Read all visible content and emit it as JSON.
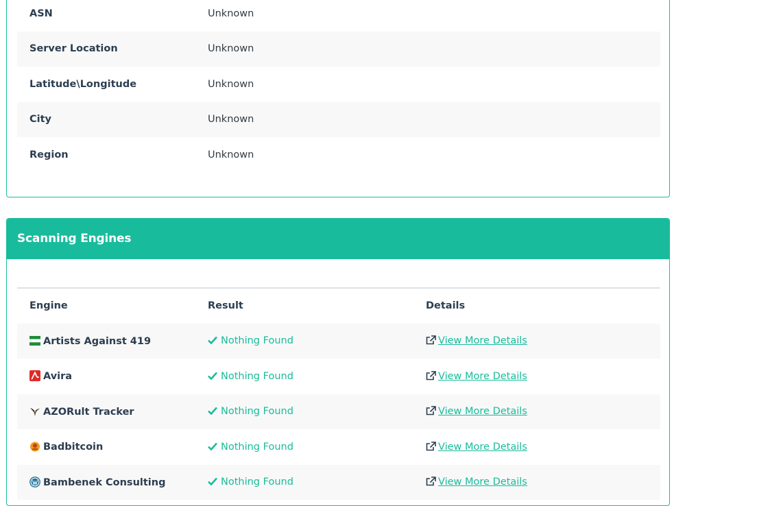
{
  "server_info": {
    "rows": [
      {
        "label": "ASN",
        "value": "Unknown"
      },
      {
        "label": "Server Location",
        "value": "Unknown"
      },
      {
        "label": "Latitude\\Longitude",
        "value": "Unknown"
      },
      {
        "label": "City",
        "value": "Unknown"
      },
      {
        "label": "Region",
        "value": "Unknown"
      }
    ]
  },
  "scanning_engines": {
    "title": "Scanning Engines",
    "columns": {
      "engine": "Engine",
      "result": "Result",
      "details": "Details"
    },
    "rows": [
      {
        "name": "Artists Against 419",
        "icon": "flag-nigeria-icon",
        "result": "Nothing Found",
        "details": "View More Details"
      },
      {
        "name": "Avira",
        "icon": "avira-logo-icon",
        "result": "Nothing Found",
        "details": "View More Details"
      },
      {
        "name": "AZORult Tracker",
        "icon": "bird-icon",
        "result": "Nothing Found",
        "details": "View More Details"
      },
      {
        "name": "Badbitcoin",
        "icon": "badbitcoin-logo-icon",
        "result": "Nothing Found",
        "details": "View More Details"
      },
      {
        "name": "Bambenek Consulting",
        "icon": "wordpress-logo-icon",
        "result": "Nothing Found",
        "details": "View More Details"
      }
    ]
  },
  "colors": {
    "accent": "#18bc9c",
    "text": "#2c3e50",
    "stripe": "#f8f8f8"
  }
}
